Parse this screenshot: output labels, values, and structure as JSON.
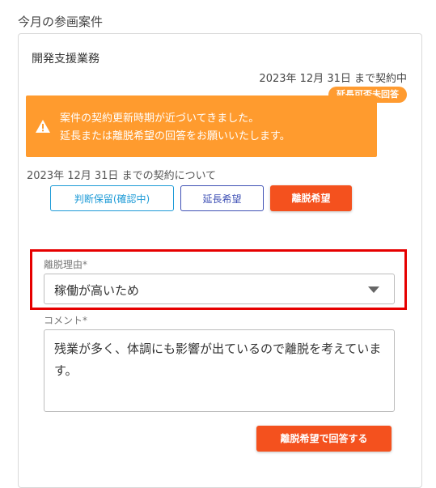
{
  "section_title": "今月の参画案件",
  "project": {
    "name": "開発支援業務",
    "contract_end": "2023年 12月 31日 まで契約中",
    "status_badge": "延長可否未回答"
  },
  "alert": {
    "line1": "案件の契約更新時期が近づいてきました。",
    "line2": "延長または離脱希望の回答をお願いいたします。"
  },
  "about_contract": "2023年 12月 31日 までの契約について",
  "choices": {
    "hold": "判断保留(確認中)",
    "extend": "延長希望",
    "leave": "離脱希望"
  },
  "reason": {
    "label": "離脱理由*",
    "value": "稼働が高いため"
  },
  "comment": {
    "label": "コメント*",
    "value": "残業が多く、体調にも影響が出ているので離脱を考えています。"
  },
  "submit_label": "離脱希望で回答する"
}
